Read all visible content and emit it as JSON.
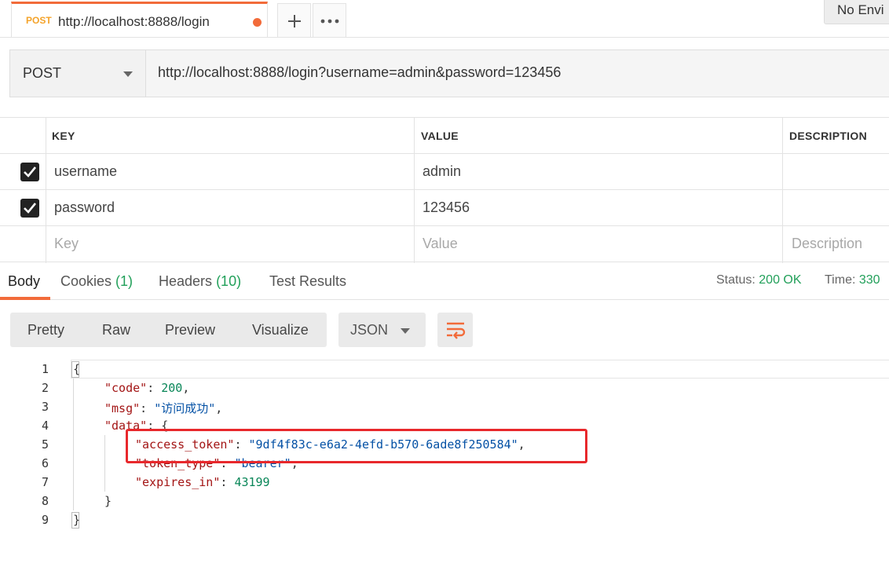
{
  "tab": {
    "method": "POST",
    "url": "http://localhost:8888/login",
    "add_label": "+",
    "more_label": "•••"
  },
  "environment": {
    "label": "No Envi"
  },
  "request": {
    "method": "POST",
    "url": "http://localhost:8888/login?username=admin&password=123456"
  },
  "params": {
    "headers": {
      "key": "KEY",
      "value": "VALUE",
      "description": "DESCRIPTION"
    },
    "rows": [
      {
        "checked": true,
        "key": "username",
        "value": "admin",
        "description": ""
      },
      {
        "checked": true,
        "key": "password",
        "value": "123456",
        "description": ""
      }
    ],
    "placeholder": {
      "key": "Key",
      "value": "Value",
      "description": "Description"
    }
  },
  "response_tabs": {
    "body": "Body",
    "cookies": "Cookies",
    "cookies_count": "(1)",
    "headers": "Headers",
    "headers_count": "(10)",
    "test_results": "Test Results"
  },
  "status": {
    "status_label": "Status:",
    "status_value": "200 OK",
    "time_label": "Time:",
    "time_value": "330"
  },
  "format": {
    "pretty": "Pretty",
    "raw": "Raw",
    "preview": "Preview",
    "visualize": "Visualize",
    "language": "JSON"
  },
  "code": {
    "line_numbers": [
      "1",
      "2",
      "3",
      "4",
      "5",
      "6",
      "7",
      "8",
      "9"
    ],
    "code_key": "\"code\"",
    "code_value": "200",
    "msg_key": "\"msg\"",
    "msg_value": "\"访问成功\"",
    "data_key": "\"data\"",
    "access_token_key": "\"access_token\"",
    "access_token_value": "\"9df4f83c-e6a2-4efd-b570-6ade8f250584\"",
    "token_type_key": "\"token_type\"",
    "token_type_value": "\"bearer\"",
    "expires_in_key": "\"expires_in\"",
    "expires_in_value": "43199"
  },
  "colors": {
    "accent": "#f26b3a",
    "status_green": "#22a05a",
    "highlight_red": "#e8282c"
  }
}
